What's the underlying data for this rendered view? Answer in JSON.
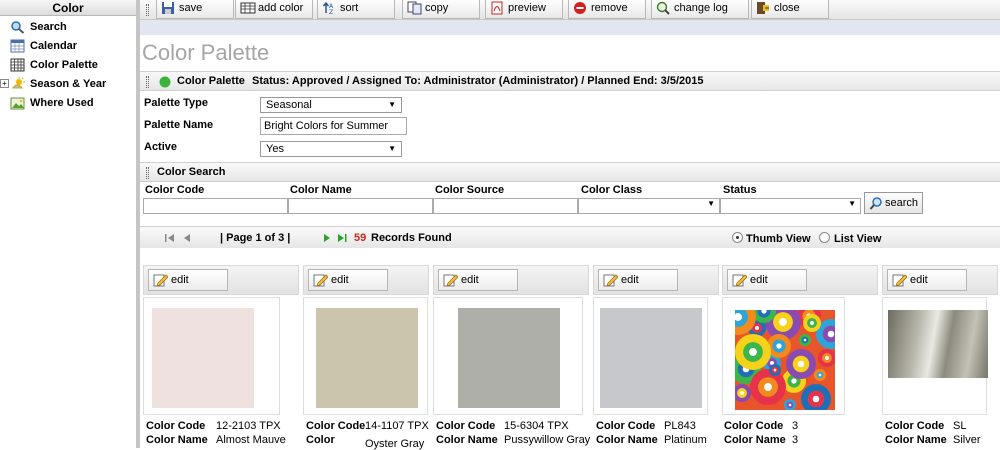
{
  "sidebar": {
    "title": "Color",
    "items": [
      {
        "label": "Search",
        "icon": "search-icon"
      },
      {
        "label": "Calendar",
        "icon": "calendar-icon"
      },
      {
        "label": "Color Palette",
        "icon": "grid-icon"
      },
      {
        "label": "Season & Year",
        "icon": "sun-icon",
        "expander": "+"
      },
      {
        "label": "Where Used",
        "icon": "image-icon"
      }
    ]
  },
  "toolbar": {
    "save": "save",
    "add_color": "add color",
    "sort": "sort",
    "copy": "copy",
    "preview": "preview",
    "remove": "remove",
    "change_log": "change log",
    "close": "close"
  },
  "page_title": "Color Palette",
  "status_bar": {
    "label": "Color Palette",
    "text": "Status: Approved / Assigned To: Administrator (Administrator) / Planned End: 3/5/2015",
    "status_color": "#3bb33b"
  },
  "form": {
    "palette_type_label": "Palette Type",
    "palette_type_value": "Seasonal",
    "palette_name_label": "Palette Name",
    "palette_name_value": "Bright Colors for Summer",
    "active_label": "Active",
    "active_value": "Yes"
  },
  "color_search": {
    "title": "Color Search",
    "code_label": "Color Code",
    "name_label": "Color Name",
    "source_label": "Color Source",
    "class_label": "Color Class",
    "status_label": "Status",
    "search_button": "search"
  },
  "pager": {
    "page_text": "| Page 1 of 3 |",
    "records_count": "59",
    "records_label": "Records Found",
    "thumb_view": "Thumb View",
    "list_view": "List View",
    "selected_view": "Thumb View"
  },
  "cards": [
    {
      "edit": "edit",
      "code_label": "Color Code",
      "code": "12-2103 TPX",
      "name_label": "Color Name",
      "name": "Almost Mauve",
      "swatch": "#eee1df",
      "pattern": "solid"
    },
    {
      "edit": "edit",
      "code_label": "Color Code",
      "code": "14-1107 TPX",
      "name_label": "Color",
      "name": "Oyster Gray",
      "swatch": "#cbc5ad",
      "pattern": "solid"
    },
    {
      "edit": "edit",
      "code_label": "Color Code",
      "code": "15-6304 TPX",
      "name_label": "Color Name",
      "name": "Pussywillow Gray",
      "swatch": "#aeafa9",
      "pattern": "solid"
    },
    {
      "edit": "edit",
      "code_label": "Color Code",
      "code": "PL843",
      "name_label": "Color Name",
      "name": "Platinum",
      "swatch": "#c6c8cb",
      "pattern": "solid"
    },
    {
      "edit": "edit",
      "code_label": "Color Code",
      "code": "3",
      "name_label": "Color Name",
      "name": "3",
      "swatch": "#e8552a",
      "pattern": "circles"
    },
    {
      "edit": "edit",
      "code_label": "Color Code",
      "code": "SL",
      "name_label": "Color Name",
      "name": "Silver",
      "swatch": "#a8a79f",
      "pattern": "metal"
    }
  ]
}
